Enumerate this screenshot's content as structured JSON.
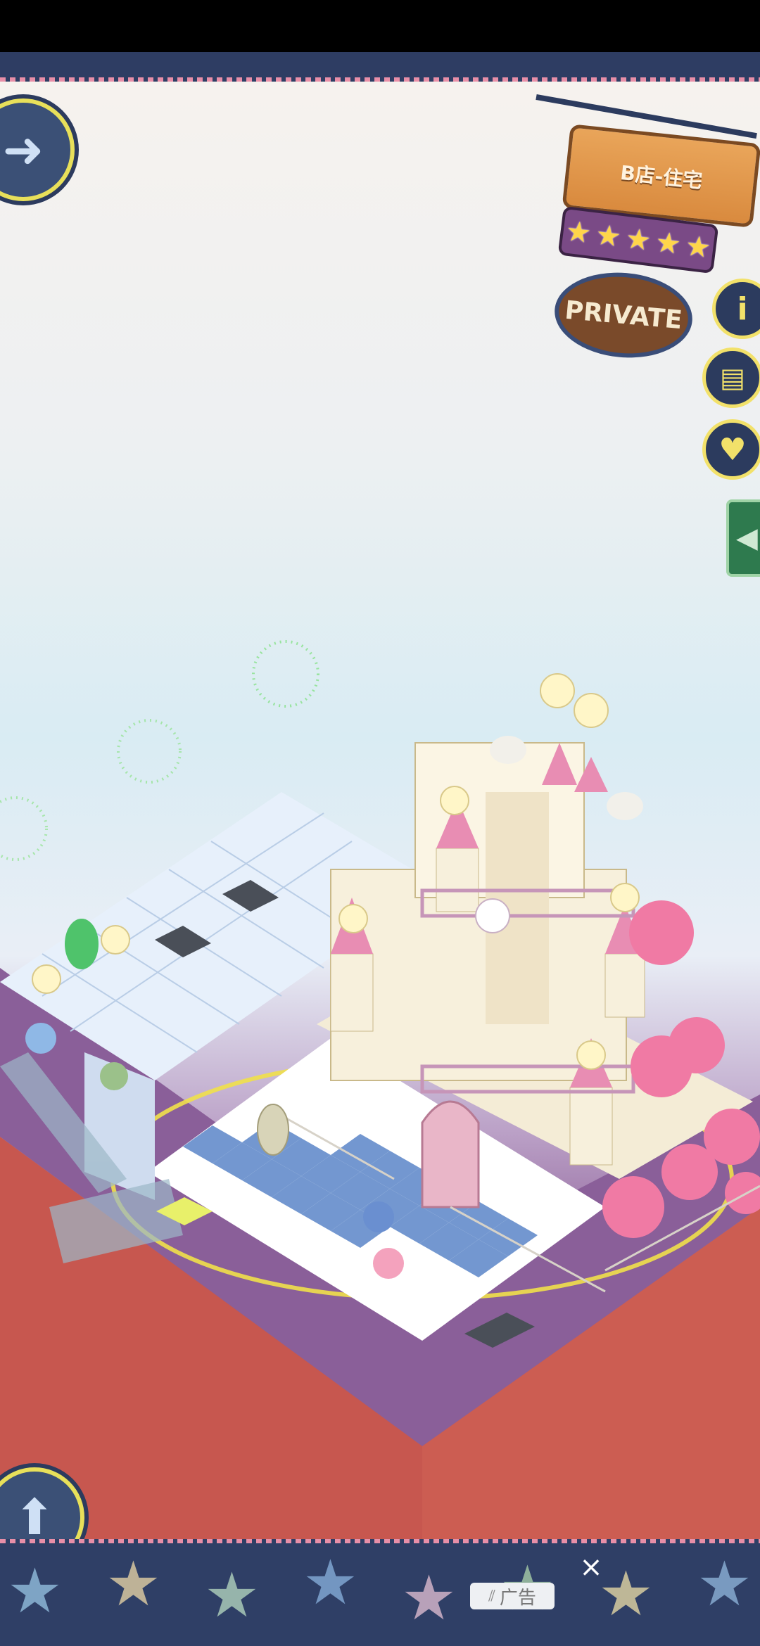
{
  "sign": {
    "title": "B店-住宅",
    "stars": [
      "★",
      "★",
      "★",
      "★",
      "★"
    ],
    "badge": "PRIVATE"
  },
  "icons": {
    "arrow_right": "arrow-right-icon",
    "arrow_up": "arrow-up-icon",
    "info": "info-icon",
    "book": "book-icon",
    "heart": "heart-icon",
    "side_tab": "chevron-left-icon",
    "close": "close-icon"
  },
  "side_buttons": {
    "info_label": "i",
    "heart_label": "♥",
    "book_label": "▤"
  },
  "ad": {
    "label": "广告",
    "close": "×"
  },
  "colors": {
    "accent_yellow": "#f2e16a",
    "band_navy": "#2f3f66",
    "sign_wood": "#d98a3e"
  }
}
